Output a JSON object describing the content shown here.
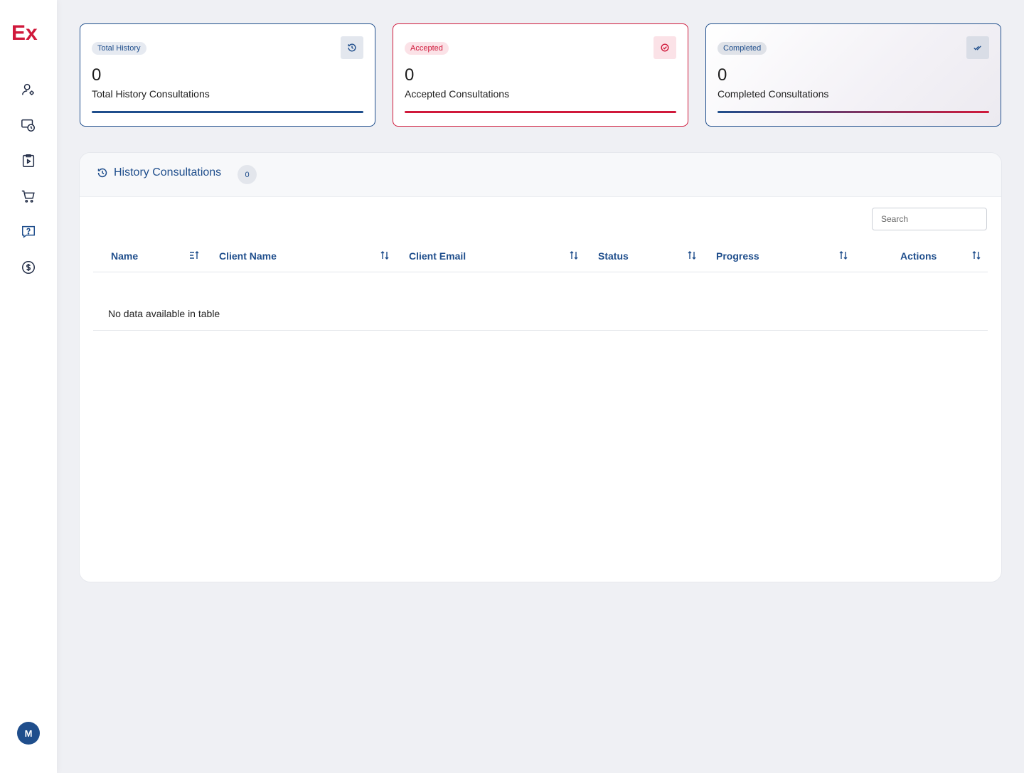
{
  "brand": {
    "logo_text": "Ex",
    "accent": "#d0193b",
    "primary": "#1f4e8c"
  },
  "sidebar": {
    "items": [
      {
        "name": "user-settings",
        "icon": "user-gear-icon"
      },
      {
        "name": "payments",
        "icon": "money-clock-icon"
      },
      {
        "name": "consultations",
        "icon": "clipboard-play-icon"
      },
      {
        "name": "cart",
        "icon": "cart-icon"
      },
      {
        "name": "questions",
        "icon": "question-message-icon"
      },
      {
        "name": "earnings",
        "icon": "dollar-circle-icon"
      }
    ],
    "avatar_initial": "M"
  },
  "stats": [
    {
      "badge": "Total History",
      "value": "0",
      "label": "Total History Consultations",
      "icon": "history-icon"
    },
    {
      "badge": "Accepted",
      "value": "0",
      "label": "Accepted Consultations",
      "icon": "check-circle-icon"
    },
    {
      "badge": "Completed",
      "value": "0",
      "label": "Completed Consultations",
      "icon": "double-check-icon"
    }
  ],
  "panel": {
    "title": "History Consultations",
    "count": "0",
    "search_placeholder": "Search",
    "columns": [
      "Name",
      "Client Name",
      "Client Email",
      "Status",
      "Progress",
      "Actions"
    ],
    "empty_message": "No data available in table"
  }
}
